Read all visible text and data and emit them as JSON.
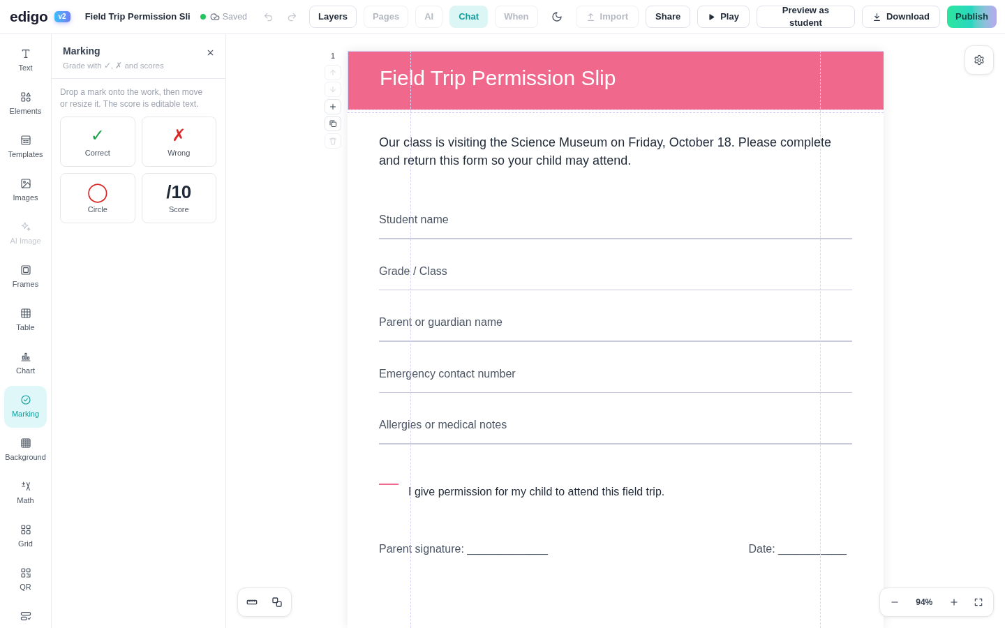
{
  "topbar": {
    "logo": "edigo",
    "version": "v2",
    "document_title": "Field Trip Permission Sli",
    "save_status": "Saved",
    "tabs": [
      {
        "label": "Layers",
        "selected": false,
        "disabled": false
      },
      {
        "label": "Pages",
        "selected": false,
        "disabled": true
      },
      {
        "label": "AI",
        "selected": false,
        "disabled": true
      },
      {
        "label": "Chat",
        "selected": true,
        "disabled": false
      },
      {
        "label": "When",
        "selected": false,
        "disabled": true
      }
    ],
    "actions": [
      {
        "kind": "upload",
        "label": "Import",
        "disabled": true
      },
      {
        "kind": "text",
        "label": "Share",
        "disabled": false
      },
      {
        "kind": "play",
        "label": "Play",
        "disabled": false
      },
      {
        "kind": "two_line",
        "label": "Preview as student",
        "disabled": false
      },
      {
        "kind": "download",
        "label": "Download",
        "disabled": false
      },
      {
        "kind": "gradient",
        "label": "Publish",
        "disabled": false
      }
    ]
  },
  "sidebar": {
    "items": [
      {
        "kind": "text",
        "label": "Text",
        "selected": false,
        "disabled": false
      },
      {
        "kind": "elements",
        "label": "Elements",
        "selected": false,
        "disabled": false
      },
      {
        "kind": "templates",
        "label": "Templates",
        "selected": false,
        "disabled": false
      },
      {
        "kind": "images",
        "label": "Images",
        "selected": false,
        "disabled": false
      },
      {
        "kind": "ai_image",
        "label": "AI Image",
        "selected": false,
        "disabled": true
      },
      {
        "kind": "frames",
        "label": "Frames",
        "selected": false,
        "disabled": false
      },
      {
        "kind": "table",
        "label": "Table",
        "selected": false,
        "disabled": false
      },
      {
        "kind": "chart",
        "label": "Chart",
        "selected": false,
        "disabled": false
      },
      {
        "kind": "marking",
        "label": "Marking",
        "selected": true,
        "disabled": false
      },
      {
        "kind": "background",
        "label": "Background",
        "selected": false,
        "disabled": false
      },
      {
        "kind": "math",
        "label": "Math",
        "selected": false,
        "disabled": false
      },
      {
        "kind": "grid",
        "label": "Grid",
        "selected": false,
        "disabled": false
      },
      {
        "kind": "qr",
        "label": "QR",
        "selected": false,
        "disabled": false
      },
      {
        "kind": "forms",
        "selected": false,
        "disabled": false
      }
    ]
  },
  "panel": {
    "title": "Marking",
    "subtitle": "Grade with ✓, ✗ and scores",
    "hint": "Drop a mark onto the work, then move or resize it. The score is editable text.",
    "marks": [
      {
        "kind": "check",
        "symbol": "✓",
        "label": "Correct"
      },
      {
        "kind": "cross",
        "symbol": "✗",
        "label": "Wrong"
      },
      {
        "kind": "circle",
        "symbol": "◯",
        "label": "Circle"
      },
      {
        "kind": "score",
        "symbol": "/10",
        "label": "Score"
      }
    ]
  },
  "canvas": {
    "page_number": "1",
    "page_controls": [
      {
        "kind": "up",
        "disabled": true
      },
      {
        "kind": "down",
        "disabled": true
      },
      {
        "kind": "add",
        "disabled": false
      },
      {
        "kind": "copy",
        "disabled": false
      },
      {
        "kind": "delete",
        "disabled": true
      }
    ],
    "page": {
      "title": "Field Trip Permission Slip",
      "intro": "Our class is visiting the Science Museum on Friday, October 18. Please complete and return this form so your child may attend.",
      "fields": [
        {
          "label": "Student name"
        },
        {
          "label": "Grade / Class"
        },
        {
          "label": "Parent or guardian name"
        },
        {
          "label": "Emergency contact number"
        },
        {
          "label": "Allergies or medical notes"
        }
      ],
      "consent": "I give permission for my child to attend this field trip.",
      "signatures": [
        "Parent signature: _____________",
        "Date: ___________"
      ]
    },
    "zoom": "94%"
  }
}
